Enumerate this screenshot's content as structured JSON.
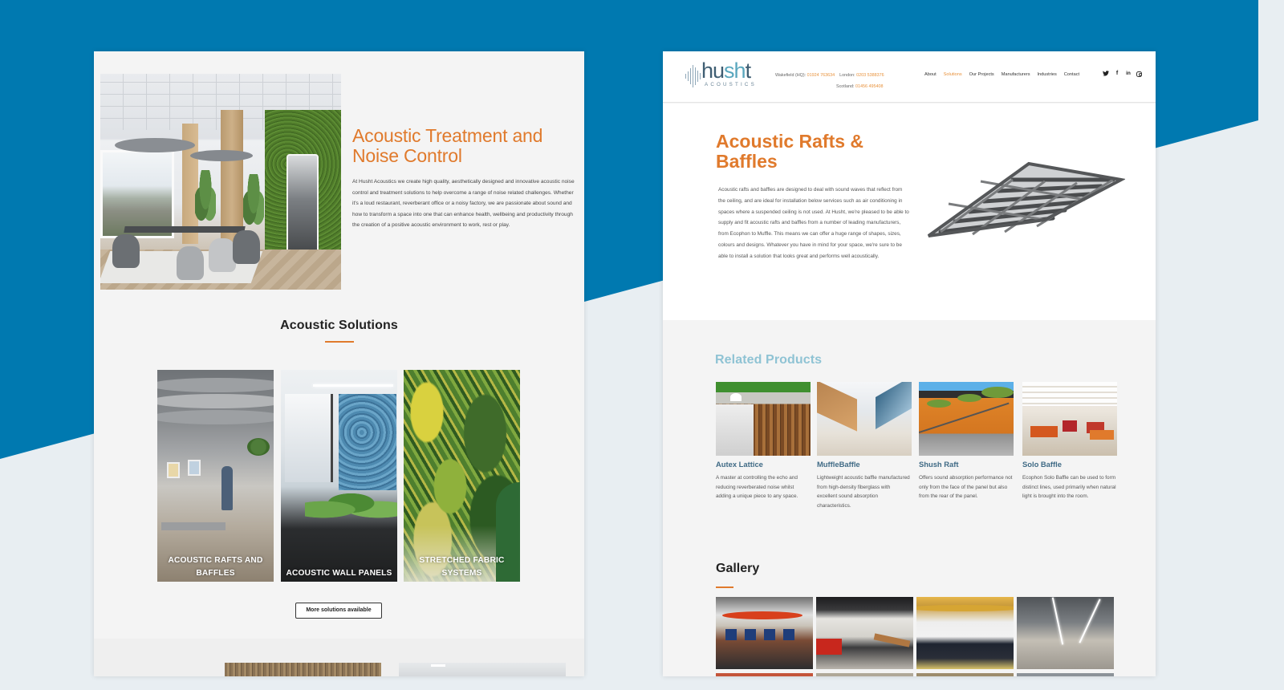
{
  "background": {
    "primary_color": "#0079B0",
    "secondary_color": "#E8EEF2"
  },
  "left_page": {
    "hero": {
      "image_alt": "office interior with moss wall and meeting booth",
      "title": "Acoustic Treatment and Noise Control",
      "body": "At Husht Acoustics we create high quality, aesthetically designed and innovative acoustic noise control and treatment solutions to help overcome a range of noise related challenges. Whether it's a loud restaurant, reverberant office or a noisy factory, we are passionate about sound and how to transform a space into one that can enhance health, wellbeing and productivity through the creation of a positive acoustic environment to work, rest or play."
    },
    "solutions": {
      "title": "Acoustic Solutions",
      "cards": [
        {
          "label": "ACOUSTIC RAFTS AND BAFFLES"
        },
        {
          "label": "ACOUSTIC WALL PANELS"
        },
        {
          "label": "STRETCHED FABRIC SYSTEMS"
        }
      ],
      "more_button": "More solutions available"
    }
  },
  "right_page": {
    "header": {
      "logo_word": "husht",
      "logo_sub": "ACOUSTICS",
      "contacts": [
        {
          "label": "Wakefield (HQ):",
          "number": "01924 763634"
        },
        {
          "label": "London:",
          "number": "0203 5388376"
        },
        {
          "label": "Scotland:",
          "number": "01456 495408"
        }
      ],
      "nav": [
        "About",
        "Solutions",
        "Our Projects",
        "Manufacturers",
        "Industries",
        "Contact"
      ],
      "active_nav": "Solutions",
      "social": [
        "twitter-icon",
        "facebook-icon",
        "linkedin-icon",
        "instagram-icon"
      ],
      "social_glyphs": {
        "twitter": "🐦",
        "facebook": "f",
        "linkedin": "in"
      }
    },
    "product": {
      "title": "Acoustic Rafts & Baffles",
      "body": "Acoustic rafts and baffles are designed to deal with sound waves that reflect from the ceiling, and are ideal for installation below services such as air conditioning in spaces where a suspended ceiling is not used. At Husht, we're pleased to be able to supply and fit acoustic rafts and baffles from a number of leading manufacturers, from Ecophon to Muffle. This means we can offer a huge range of shapes, sizes, colours and designs. Whatever you have in mind for your space, we're sure to be able to install a solution that looks great and performs well acoustically."
    },
    "related": {
      "title": "Related Products",
      "items": [
        {
          "name": "Autex Lattice",
          "desc": "A master at controlling the echo and reducing reverberated noise whilst adding a unique piece to any space."
        },
        {
          "name": "MuffleBaffle",
          "desc": "Lightweight acoustic baffle manufactured from high-density fiberglass with excellent sound absorption characteristics."
        },
        {
          "name": "Shush Raft",
          "desc": "Offers sound absorption performance not only from the face of the panel but also from the rear of the panel."
        },
        {
          "name": "Solo Baffle",
          "desc": "Ecophon Solo Baffle can be used to form distinct lines, used primarily when natural light is brought into the room."
        }
      ]
    },
    "gallery": {
      "title": "Gallery",
      "count_visible": 4
    }
  }
}
